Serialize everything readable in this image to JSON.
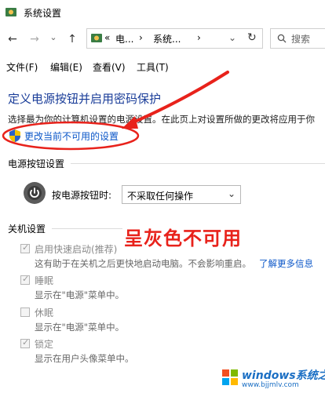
{
  "window": {
    "title": "系统设置"
  },
  "nav": {
    "back_icon": "←",
    "forward_icon": "→",
    "recent_icon": "⌄",
    "up_icon": "↑",
    "address_prefix": "«",
    "address_seg1": "电...",
    "address_sep": "›",
    "address_seg2": "系统...",
    "refresh_icon": "↻",
    "search_placeholder": "搜索"
  },
  "menu": {
    "file": "文件(F)",
    "edit": "编辑(E)",
    "view": "查看(V)",
    "tools": "工具(T)"
  },
  "page": {
    "title": "定义电源按钮并启用密码保护",
    "description": "选择最为你的计算机设置的电源设置。在此页上对设置所做的更改将应用于你",
    "change_link": "更改当前不可用的设置"
  },
  "power_section": {
    "heading": "电源按钮设置",
    "label": "按电源按钮时:",
    "selected": "不采取任何操作",
    "arrow": "⌄"
  },
  "shutdown_section": {
    "heading": "关机设置",
    "options": [
      {
        "label": "启用快速启动(推荐)",
        "sub": "这有助于在关机之后更快地启动电脑。不会影响重启。",
        "link": "了解更多信息",
        "checked": true
      },
      {
        "label": "睡眠",
        "sub": "显示在\"电源\"菜单中。",
        "checked": true
      },
      {
        "label": "休眠",
        "sub": "显示在\"电源\"菜单中。",
        "checked": false
      },
      {
        "label": "锁定",
        "sub": "显示在用户头像菜单中。",
        "checked": true
      }
    ]
  },
  "annotation": {
    "text": "呈灰色不可用"
  },
  "watermark": {
    "main": "windows系统之家",
    "sub": "www.bjjmlv.com"
  },
  "colors": {
    "link": "#0a56c8",
    "title": "#1a3d99",
    "annotation": "#e8221b"
  }
}
